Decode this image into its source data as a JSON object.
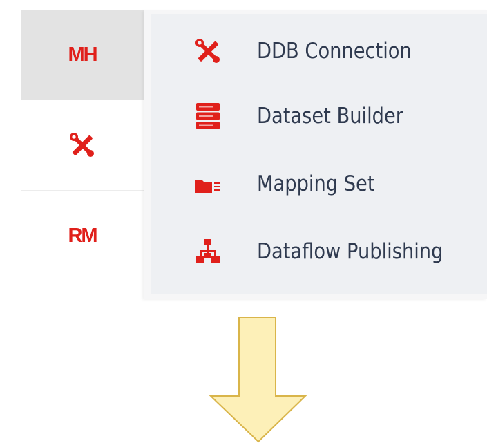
{
  "sidebar": {
    "items": [
      {
        "label": "MH",
        "active": true
      },
      {
        "icon": "wrench-screwdriver-icon"
      },
      {
        "label": "RM"
      }
    ]
  },
  "menu": {
    "items": [
      {
        "label": "DDB Connection",
        "icon": "wrench-screwdriver-icon"
      },
      {
        "label": "Dataset Builder",
        "icon": "server-stack-icon"
      },
      {
        "label": "Mapping Set",
        "icon": "folder-list-icon"
      },
      {
        "label": "Dataflow Publishing",
        "icon": "sitemap-icon"
      }
    ]
  },
  "colors": {
    "accent": "#e0201b",
    "menu_background": "#eef0f3",
    "menu_text": "#2f3a4f",
    "active_row": "#e3e3e3",
    "arrow_fill": "#fdf0b8",
    "arrow_stroke": "#d9b54a"
  }
}
